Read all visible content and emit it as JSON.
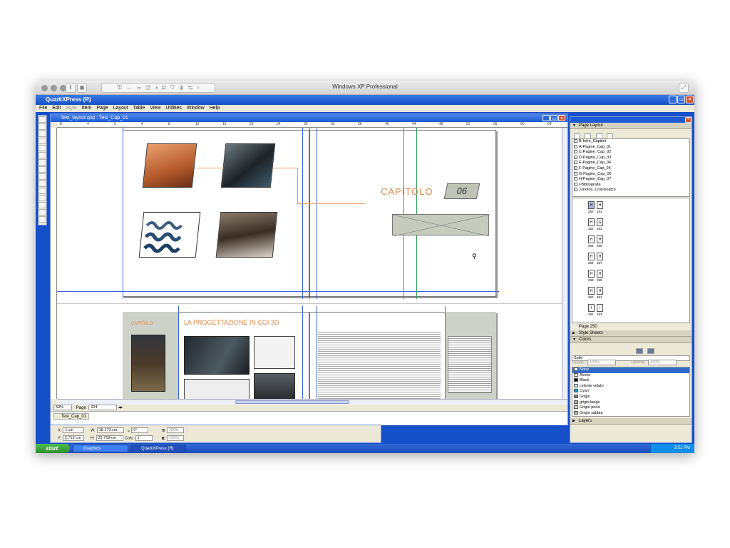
{
  "mac": {
    "window_title": "Windows XP Professional"
  },
  "app": {
    "title": "QuarkXPress (R)",
    "menu": [
      "File",
      "Edit",
      "Style",
      "Item",
      "Page",
      "Layout",
      "Table",
      "View",
      "Utilities",
      "Window",
      "Help"
    ]
  },
  "document": {
    "title": "Tesi_layout.qxp : Tesi_Cap_01",
    "ruler_numbers": [
      "8",
      "4",
      "0",
      "4",
      "8",
      "12",
      "16",
      "20",
      "24",
      "28",
      "32",
      "36",
      "40",
      "44",
      "48",
      "52",
      "56",
      "60",
      "64"
    ],
    "status_zoom": "59%",
    "status_page_label": "Page",
    "status_page_value": "224",
    "layout_tab": "Tesi_Cap_01",
    "chapter_title": "CAPITOLO",
    "chapter_number": "06",
    "section_heading": "LA PROGETTAZIONE IN CGI 3D",
    "small_chapter_label": "CAPITOLO"
  },
  "measurements": {
    "x_label": "X:",
    "x_value": "1 cm",
    "y_label": "Y:",
    "y_value": "2.716 cm",
    "w_label": "W:",
    "w_value": "18.173 cm",
    "h_label": "H:",
    "h_value": "23.759 cm",
    "angle_label": "⦣",
    "angle_value": "0°",
    "cols_label": "Cols:",
    "cols_value": "1",
    "scale_1": "100%",
    "scale_2": "100%"
  },
  "page_layout_panel": {
    "title": "Page Layout",
    "masters": [
      "B-Intro_Capitoli",
      "A-Pagine_Cap_01",
      "C-Pagine_Cap_02",
      "D-Pagine_Cap_03",
      "E-Pagine_Cap_04",
      "F-Pagine_Cap_05",
      "G-Pagine_Cap_06",
      "H-Pagine_Cap_07",
      "I-Bibliografia",
      "J-Indice_Cronologico"
    ],
    "thumbs": [
      {
        "l": "H",
        "r": "H",
        "nl": "250",
        "nr": "251"
      },
      {
        "l": "H",
        "r": "G",
        "nl": "252",
        "nr": "253"
      },
      {
        "l": "H",
        "r": "H",
        "nl": "254",
        "nr": "255"
      },
      {
        "l": "H",
        "r": "H",
        "nl": "256",
        "nr": "257"
      },
      {
        "l": "H",
        "r": "H",
        "nl": "258",
        "nr": "259"
      },
      {
        "l": "H",
        "r": "H",
        "nl": "260",
        "nr": "261"
      },
      {
        "l": "I",
        "r": "I",
        "nl": "262",
        "nr": "263"
      }
    ],
    "footer": "Page 250"
  },
  "style_sheets_panel": {
    "title": "Style Sheets"
  },
  "colors_panel": {
    "title": "Colors",
    "fill_type": "Solid",
    "shade_label": "Shade:",
    "shade_value": "100%",
    "opacity_label": "Opacity:",
    "opacity_value": "100%",
    "items": [
      {
        "name": "None",
        "color": "#ffffff",
        "selected": true
      },
      {
        "name": "Avorio",
        "color": "#fff8e0"
      },
      {
        "name": "Black",
        "color": "#000000"
      },
      {
        "name": "celeste velato",
        "color": "#cfe2ef"
      },
      {
        "name": "Cyan",
        "color": "#00a0e6"
      },
      {
        "name": "Grigio",
        "color": "#808080"
      },
      {
        "name": "grigio beige",
        "color": "#b8b09a"
      },
      {
        "name": "Grigio perla",
        "color": "#d8d8d8"
      },
      {
        "name": "Grigio sabbia",
        "color": "#c2b9a4"
      }
    ]
  },
  "layers_panel": {
    "title": "Layers"
  },
  "taskbar": {
    "start": "start",
    "tasks": [
      "Graphics",
      "QuarkXPress (R)"
    ],
    "clock": "3:51 PM"
  },
  "colors": {
    "accent_orange": "#e88a4a",
    "guide_blue": "#3a66e0",
    "xp_blue": "#1650c8"
  }
}
